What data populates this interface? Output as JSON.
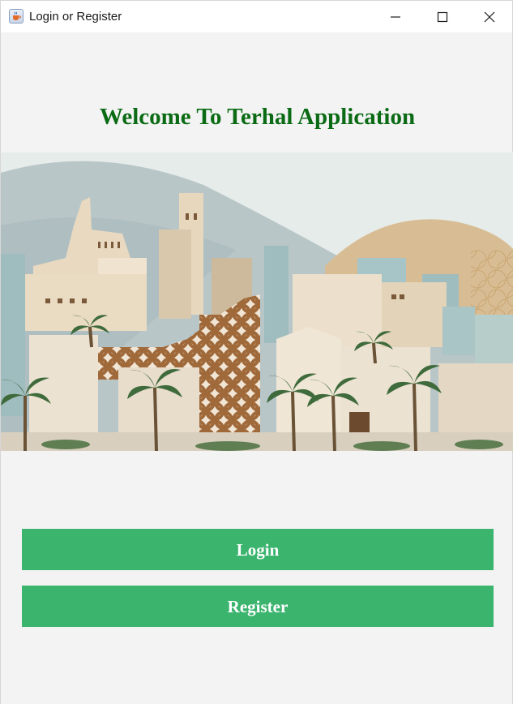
{
  "window": {
    "title": "Login or Register",
    "app_icon": "java-cup-icon",
    "controls": [
      "minimize-icon",
      "maximize-icon",
      "close-icon"
    ]
  },
  "main": {
    "heading": "Welcome To Terhal Application",
    "banner_image": "saudi-old-town-illustration",
    "login_label": "Login",
    "register_label": "Register"
  },
  "colors": {
    "heading": "#0a6b14",
    "button_bg": "#3bb46e",
    "button_text": "#ffffff",
    "window_bg": "#f3f3f3"
  }
}
